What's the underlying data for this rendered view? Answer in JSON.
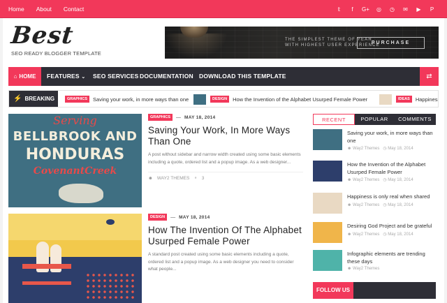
{
  "topbar": {
    "links": [
      "Home",
      "About",
      "Contact"
    ],
    "social_icons": [
      "twitter-icon",
      "facebook-icon",
      "google-plus-icon",
      "instagram-icon",
      "rss-icon",
      "email-icon",
      "youtube-icon",
      "pinterest-icon"
    ]
  },
  "header": {
    "logo_name": "Best",
    "logo_tagline": "SEO READY BLOGGER TEMPLATE",
    "banner": {
      "line1": "THE SIMPLEST THEME OF YEAR",
      "line2": "WITH HIGHEST USER EXPERIENCE",
      "button": "PURCHASE"
    }
  },
  "menu": {
    "home": "HOME",
    "items": [
      "FEATURES",
      "SEO SERVICES",
      "DOCUMENTATION",
      "DOWNLOAD THIS TEMPLATE"
    ]
  },
  "breaking": {
    "label": "BREAKING",
    "items": [
      {
        "tag": "GRAPHICS",
        "text": "Saving your work, in more ways than one"
      },
      {
        "tag": "DESIGN",
        "text": "How the Invention of the Alphabet Usurped Female Power"
      },
      {
        "tag": "IDEAS",
        "text": "Happiness i"
      }
    ]
  },
  "posts": [
    {
      "tag": "GRAPHICS",
      "date": "MAY 18, 2014",
      "title": "Saving Your Work, In More Ways Than One",
      "excerpt": "A post without sidebar and narrow width created using some basic elements including a quote, ordered list and a popup image. As a web designer...",
      "author": "WAY2 THEMES",
      "comments": "3",
      "image_text": {
        "script": "Serving",
        "line1": "BELLBROOK AND",
        "line2": "HONDURAS",
        "line3": "CovenantCreek"
      }
    },
    {
      "tag": "DESIGN",
      "date": "MAY 18, 2014",
      "title": "How The Invention Of The Alphabet Usurped Female Power",
      "excerpt": "A standard post created using some basic elements including a quote, ordered list and a popup image. As a web designer you need to consider what people..."
    }
  ],
  "sidebar": {
    "tabs": [
      "RECENT",
      "POPULAR",
      "COMMENTS"
    ],
    "items": [
      {
        "title": "Saving your work, in more ways than one",
        "author": "Way2 Themes",
        "date": "May 18, 2014"
      },
      {
        "title": "How the Invention of the Alphabet Usurped Female Power",
        "author": "Way2 Themes",
        "date": "May 18, 2014"
      },
      {
        "title": "Happiness is only real when shared",
        "author": "Way2 Themes",
        "date": "May 18, 2014"
      },
      {
        "title": "Desiring God Project and be grateful",
        "author": "Way2 Themes",
        "date": "May 18, 2014"
      },
      {
        "title": "Infographic elements are trending these days",
        "author": "Way2 Themes",
        "date": "May 18, 2014"
      }
    ],
    "follow_label": "FOLLOW US"
  },
  "colors": {
    "accent": "#f2385a",
    "dark": "#2e2e36"
  }
}
